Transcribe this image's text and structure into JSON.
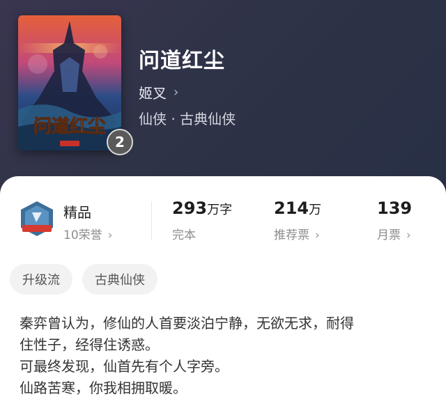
{
  "book": {
    "title": "问道红尘",
    "author": "姬叉",
    "genre": "仙侠 · 古典仙侠",
    "cover_text": "问道红尘",
    "cover_badge": "2"
  },
  "stats": {
    "honor_title": "精品",
    "honor_sub": "10荣誉",
    "words_value": "293",
    "words_unit": "万字",
    "words_label": "完本",
    "rec_value": "214",
    "rec_unit": "万",
    "rec_label": "推荐票",
    "monthly_value": "139",
    "monthly_label": "月票"
  },
  "tags": [
    "升级流",
    "古典仙侠"
  ],
  "description": [
    "秦弈曾认为，修仙的人首要淡泊宁静，无欲无求，耐得",
    "住性子，经得住诱惑。",
    "可最终发现，仙首先有个人字旁。",
    "仙路苦寒，你我相拥取暖。"
  ]
}
